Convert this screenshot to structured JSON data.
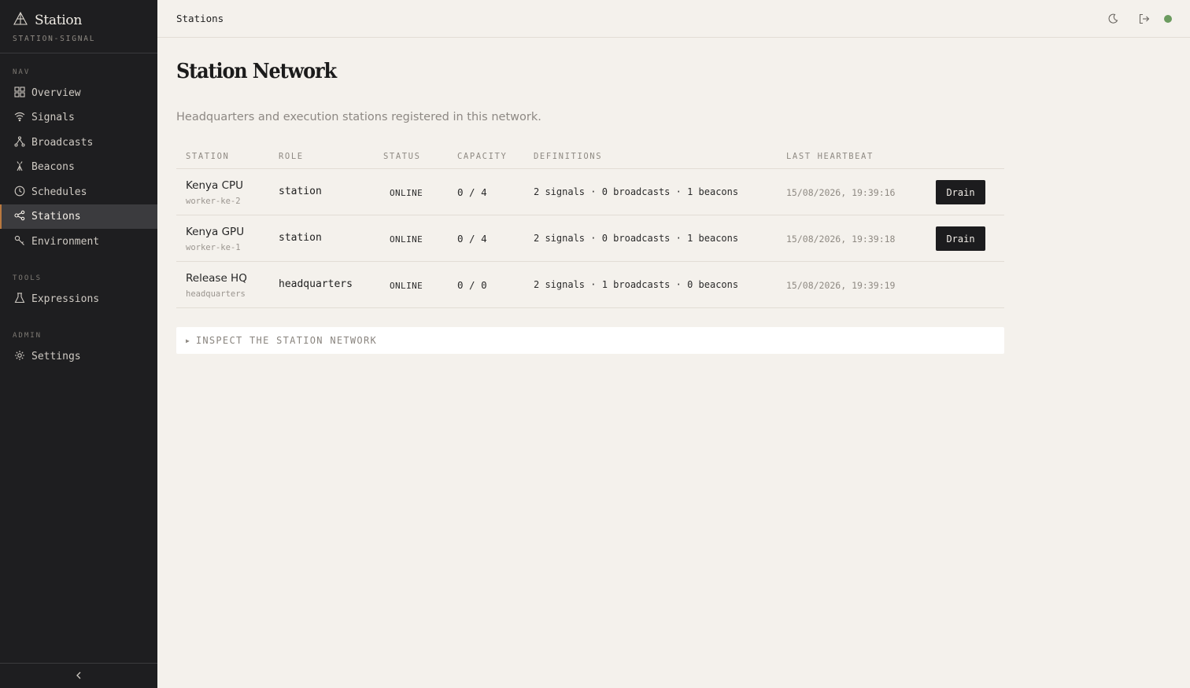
{
  "sidebar": {
    "brand_title": "Station",
    "brand_subtitle": "STATION-SIGNAL",
    "sections": {
      "nav": "NAV",
      "tools": "TOOLS",
      "admin": "ADMIN"
    },
    "nav_items": [
      {
        "label": "Overview",
        "icon": "grid-icon"
      },
      {
        "label": "Signals",
        "icon": "wifi-icon"
      },
      {
        "label": "Broadcasts",
        "icon": "fork-icon"
      },
      {
        "label": "Beacons",
        "icon": "beacon-icon"
      },
      {
        "label": "Schedules",
        "icon": "clock-icon"
      },
      {
        "label": "Stations",
        "icon": "network-icon",
        "active": true
      },
      {
        "label": "Environment",
        "icon": "key-icon"
      }
    ],
    "tool_items": [
      {
        "label": "Expressions",
        "icon": "flask-icon"
      }
    ],
    "admin_items": [
      {
        "label": "Settings",
        "icon": "gear-icon"
      }
    ]
  },
  "topbar": {
    "title": "Stations"
  },
  "main": {
    "title": "Station Network",
    "description": "Headquarters and execution stations registered in this network.",
    "columns": [
      "STATION",
      "ROLE",
      "STATUS",
      "CAPACITY",
      "DEFINITIONS",
      "LAST HEARTBEAT"
    ],
    "rows": [
      {
        "name": "Kenya CPU",
        "id": "worker-ke-2",
        "role": "station",
        "status": "ONLINE",
        "capacity": "0 / 4",
        "definitions": "2 signals · 0 broadcasts · 1 beacons",
        "heartbeat": "15/08/2026, 19:39:16",
        "action": "Drain"
      },
      {
        "name": "Kenya GPU",
        "id": "worker-ke-1",
        "role": "station",
        "status": "ONLINE",
        "capacity": "0 / 4",
        "definitions": "2 signals · 0 broadcasts · 1 beacons",
        "heartbeat": "15/08/2026, 19:39:18",
        "action": "Drain"
      },
      {
        "name": "Release HQ",
        "id": "headquarters",
        "role": "headquarters",
        "status": "ONLINE",
        "capacity": "0 / 0",
        "definitions": "2 signals · 1 broadcasts · 0 beacons",
        "heartbeat": "15/08/2026, 19:39:19"
      }
    ],
    "inspect_label": "INSPECT THE STATION NETWORK"
  },
  "colors": {
    "sidebar_bg": "#1e1e20",
    "page_bg": "#f4f1ec",
    "active_accent": "#b9793f",
    "status_online": "#6b9b5f"
  }
}
